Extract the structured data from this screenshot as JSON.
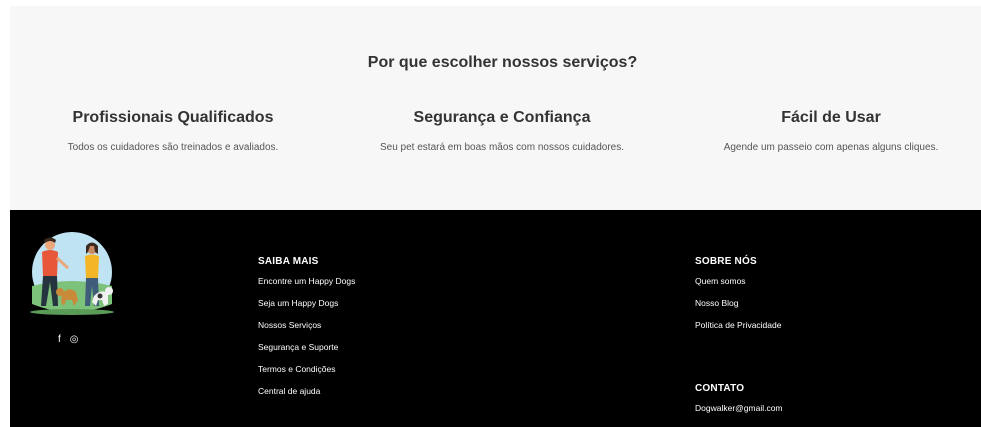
{
  "why": {
    "title": "Por que escolher nossos serviços?",
    "features": [
      {
        "title": "Profissionais Qualificados",
        "text": "Todos os cuidadores são treinados e avaliados."
      },
      {
        "title": "Segurança e Confiança",
        "text": "Seu pet estará em boas mãos com nossos cuidadores."
      },
      {
        "title": "Fácil de Usar",
        "text": "Agende um passeio com apenas alguns cliques."
      }
    ]
  },
  "footer": {
    "social": {
      "facebook": "f",
      "instagram": "◎"
    },
    "saiba_mais": {
      "title": "SAIBA MAIS",
      "links": [
        "Encontre um Happy Dogs",
        "Seja um Happy Dogs",
        "Nossos Serviços",
        "Segurança e Suporte",
        "Termos e Condições",
        "Central de ajuda"
      ]
    },
    "sobre_nos": {
      "title": "SOBRE NÓS",
      "links": [
        "Quem somos",
        "Nosso Blog",
        "Política de Privacidade"
      ]
    },
    "contato": {
      "title": "CONTATO",
      "email": "Dogwalker@gmail.com"
    }
  },
  "colors": {
    "section_bg": "#f7f7f7",
    "footer_bg": "#000000",
    "heading": "#333333",
    "text": "#555555"
  }
}
